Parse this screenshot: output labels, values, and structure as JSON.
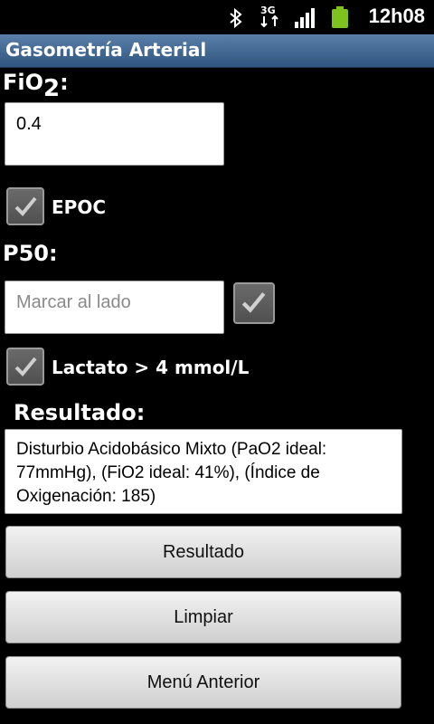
{
  "status_bar": {
    "time": "12h08",
    "network_label": "3G",
    "icons": [
      "bluetooth-icon",
      "3g-data-icon",
      "signal-icon",
      "battery-icon"
    ]
  },
  "app": {
    "title": "Gasometría Arterial"
  },
  "fio2": {
    "label_main": "FiO",
    "label_sub": "2",
    "label_colon": ":",
    "value": "0.4"
  },
  "epoc": {
    "label": "EPOC",
    "checked": true
  },
  "p50": {
    "label": "P50:",
    "placeholder": "Marcar al lado",
    "checked": true
  },
  "lactato": {
    "label": "Lactato > 4 mmol/L",
    "checked": true
  },
  "resultado": {
    "label": "Resultado:",
    "text": "Disturbio Acidobásico Mixto (PaO2 ideal: 77mmHg), (FiO2 ideal: 41%), (Índice de Oxigenación: 185)"
  },
  "buttons": {
    "resultado": "Resultado",
    "limpiar": "Limpiar",
    "menu_anterior": "Menú Anterior"
  },
  "colors": {
    "title_bar": "#3c6491",
    "background": "#000000",
    "battery": "#7ec21d"
  }
}
